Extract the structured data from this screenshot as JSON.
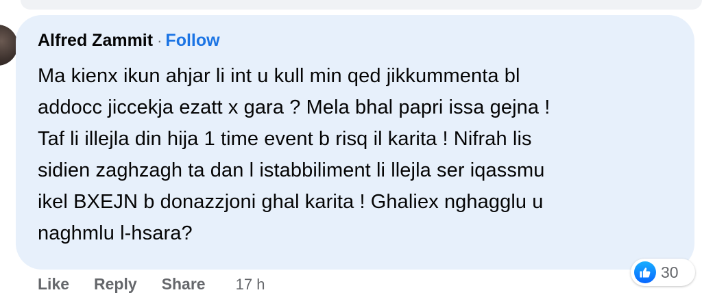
{
  "comment": {
    "author": "Alfred Zammit",
    "separator": "·",
    "follow_label": "Follow",
    "text": "Ma kienx ikun ahjar li int u kull min qed jikkummenta bl\naddocc jiccekja ezatt x gara ? Mela bhal papri issa gejna !\nTaf li illejla din hija 1 time event b risq il karita ! Nifrah lis\nsidien zaghzagh ta dan l istabbiliment li llejla ser iqassmu\nikel BXEJN b donazzjoni ghal karita ! Ghaliex nghagglu u\nnaghmlu l-hsara?",
    "actions": {
      "like_label": "Like",
      "reply_label": "Reply",
      "share_label": "Share"
    },
    "timestamp": "17 h",
    "reactions": {
      "icon": "like-thumb-icon",
      "count": "30"
    }
  },
  "colors": {
    "bubble": "#e7f0fb",
    "follow": "#1b74e4",
    "muted": "#65676b",
    "like": "#0866ff"
  }
}
